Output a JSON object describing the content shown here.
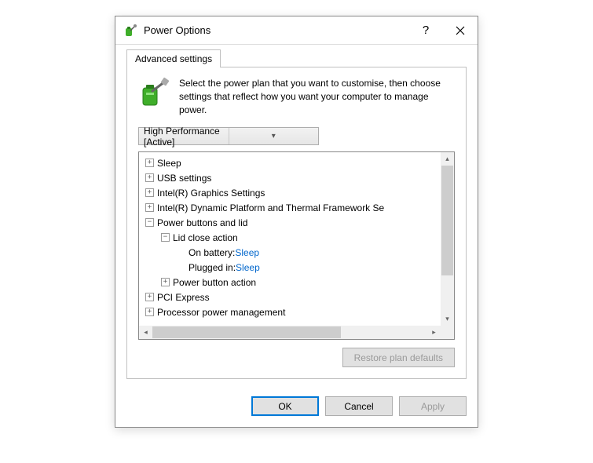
{
  "titlebar": {
    "title": "Power Options"
  },
  "tab": {
    "label": "Advanced settings"
  },
  "intro": {
    "text": "Select the power plan that you want to customise, then choose settings that reflect how you want your computer to manage power."
  },
  "plan_select": {
    "value": "High Performance [Active]"
  },
  "tree": {
    "items": [
      {
        "level": 0,
        "exp": "+",
        "label": "Sleep"
      },
      {
        "level": 0,
        "exp": "+",
        "label": "USB settings"
      },
      {
        "level": 0,
        "exp": "+",
        "label": "Intel(R) Graphics Settings"
      },
      {
        "level": 0,
        "exp": "+",
        "label": "Intel(R) Dynamic Platform and Thermal Framework Se"
      },
      {
        "level": 0,
        "exp": "-",
        "label": "Power buttons and lid"
      },
      {
        "level": 1,
        "exp": "-",
        "label": "Lid close action"
      },
      {
        "level": 2,
        "label": "On battery:",
        "value": "Sleep"
      },
      {
        "level": 2,
        "label": "Plugged in:",
        "value": "Sleep"
      },
      {
        "level": 1,
        "exp": "+",
        "label": "Power button action"
      },
      {
        "level": 0,
        "exp": "+",
        "label": "PCI Express"
      },
      {
        "level": 0,
        "exp": "+",
        "label": "Processor power management"
      }
    ]
  },
  "buttons": {
    "restore": "Restore plan defaults",
    "ok": "OK",
    "cancel": "Cancel",
    "apply": "Apply"
  }
}
